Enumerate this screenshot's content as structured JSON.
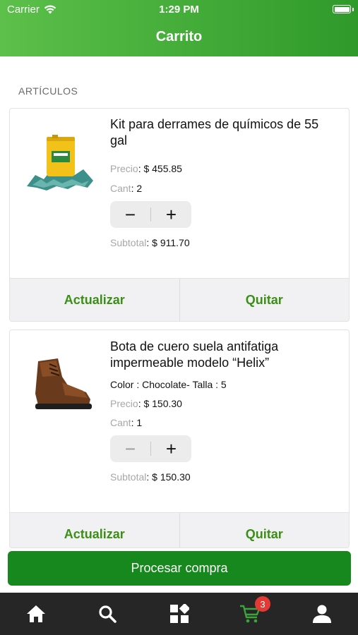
{
  "status_bar": {
    "carrier": "Carrier",
    "time": "1:29 PM"
  },
  "header": {
    "title": "Carrito"
  },
  "section": {
    "label": "ARTÍCULOS"
  },
  "items": [
    {
      "title": "Kit para derrames de químicos de 55 gal",
      "price_label": "Precio",
      "price": ": $ 455.85",
      "qty_label": "Cant",
      "qty": ": 2",
      "subtotal_label": "Subtotal",
      "subtotal": ": $ 911.70",
      "update_label": "Actualizar",
      "remove_label": "Quitar"
    },
    {
      "title": "Bota de cuero suela antifatiga impermeable modelo “Helix”",
      "variant": "Color : Chocolate- Talla : 5",
      "price_label": "Precio",
      "price": ": $ 150.30",
      "qty_label": "Cant",
      "qty": ": 1",
      "subtotal_label": "Subtotal",
      "subtotal": ": $ 150.30",
      "update_label": "Actualizar",
      "remove_label": "Quitar"
    }
  ],
  "checkout": {
    "label": "Procesar compra"
  },
  "tabbar": {
    "cart_badge": "3",
    "tabs": [
      "home-icon",
      "search-icon",
      "categories-icon",
      "cart-icon",
      "user-icon"
    ],
    "active_color": "#3aa53a",
    "inactive_color": "#ffffff"
  },
  "colors": {
    "brand_green": "#17881e",
    "action_green": "#3a8f14",
    "header_gradient": [
      "#5cc04a",
      "#2f9a2a"
    ]
  }
}
